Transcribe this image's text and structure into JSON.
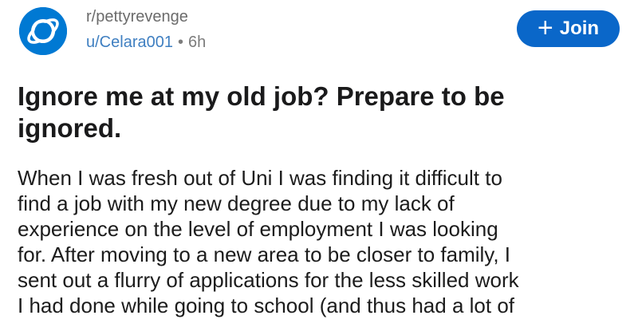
{
  "post": {
    "subreddit": "r/pettyrevenge",
    "author": "u/Celara001",
    "separator": "•",
    "time_ago": "6h",
    "join_label": "Join",
    "join_icon": "+",
    "title": "Ignore me at my old job? Prepare to be ignored.",
    "body_lines": [
      "When I was fresh out of Uni I was finding it difficult to",
      "find a job with my new degree due to my lack of",
      "experience on the level of employment I was looking",
      "for. After moving to a new area to be closer to family, I",
      "sent out a flurry of applications for the less skilled work",
      "I had done while going to school (and thus had a lot of"
    ]
  },
  "colors": {
    "brand_blue": "#0079d3",
    "join_button": "#0a67c9"
  },
  "icons": {
    "avatar": "planet-icon"
  }
}
